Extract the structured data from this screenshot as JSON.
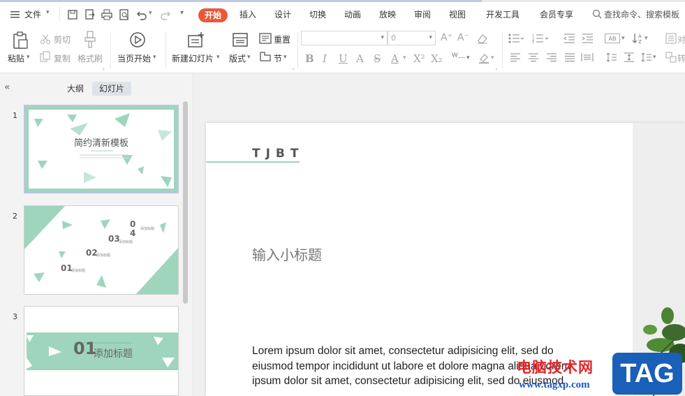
{
  "menubar": {
    "file_label": "文件",
    "tabs": [
      "开始",
      "插入",
      "设计",
      "切换",
      "动画",
      "放映",
      "审阅",
      "视图",
      "开发工具",
      "会员专享"
    ],
    "active_tab": "开始",
    "search_label": "查找命令、搜索模板"
  },
  "ribbon": {
    "paste": "粘贴",
    "cut": "剪切",
    "copy": "复制",
    "format_painter": "格式刷",
    "from_start": "当页开始",
    "new_slide": "新建幻灯片",
    "layout": "版式",
    "reset": "重置",
    "section": "节",
    "font_size_value": "0"
  },
  "left_pane": {
    "tab_outline": "大纲",
    "tab_slides": "幻灯片",
    "slides": [
      {
        "num": "1",
        "title": "简约清新模板"
      },
      {
        "num": "2",
        "items": [
          "01",
          "02",
          "03",
          "0\n4"
        ],
        "item_label": "添加标题"
      },
      {
        "num": "3",
        "num_text": "01",
        "title": "添加标题"
      }
    ]
  },
  "slide": {
    "brand": "TJBT",
    "subtitle": "输入小标题",
    "body": "Lorem ipsum dolor sit amet, consectetur adipisicing elit, sed do eiusmod tempor incididunt ut labore et dolore magna aliqua.Lorem ipsum dolor sit amet, consectetur adipisicing elit, sed do eiusmod"
  },
  "watermark": {
    "cn": "电脑技术网",
    "url": "www.tagxp.com",
    "tag": "TAG"
  },
  "colors": {
    "accent": "#e8593a",
    "mint": "#9fd5bd",
    "selection": "#b9c7dd"
  }
}
